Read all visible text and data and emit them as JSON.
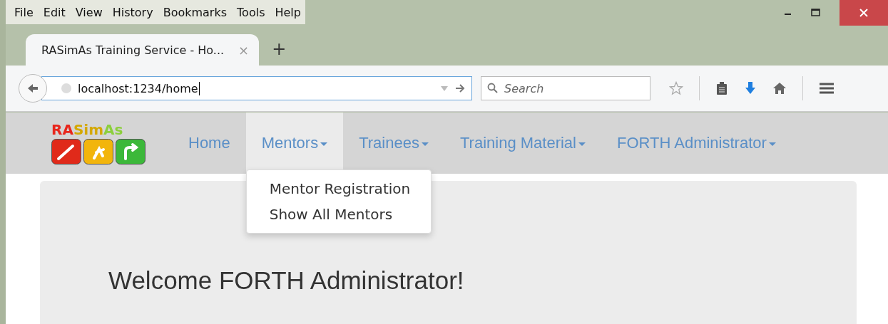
{
  "menu_bar": [
    "File",
    "Edit",
    "View",
    "History",
    "Bookmarks",
    "Tools",
    "Help"
  ],
  "tabs": [
    {
      "title": "RASimAs Training Service - Ho...",
      "selected": true,
      "close": "×"
    }
  ],
  "new_tab": "+",
  "address_bar": {
    "value": "localhost:1234/home"
  },
  "search": {
    "placeholder": "Search"
  },
  "logo": {
    "parts": [
      {
        "text": "RA",
        "color": "#e8261c"
      },
      {
        "text": "Sim",
        "color": "#d4a800"
      },
      {
        "text": "As",
        "color": "#8ccf3c"
      }
    ],
    "tiles": [
      {
        "color": "#e02a1a"
      },
      {
        "color": "#f2b50c"
      },
      {
        "color": "#3cb83a"
      }
    ]
  },
  "nav": [
    {
      "label": "Home",
      "dropdown": false,
      "selected": false
    },
    {
      "label": "Mentors",
      "dropdown": true,
      "selected": true
    },
    {
      "label": "Trainees",
      "dropdown": true,
      "selected": false
    },
    {
      "label": "Training Material",
      "dropdown": true,
      "selected": false
    },
    {
      "label": "FORTH Administrator",
      "dropdown": true,
      "selected": false
    }
  ],
  "dropdown_menu": [
    "Mentor Registration",
    "Show All Mentors"
  ],
  "welcome": "Welcome FORTH Administrator!"
}
